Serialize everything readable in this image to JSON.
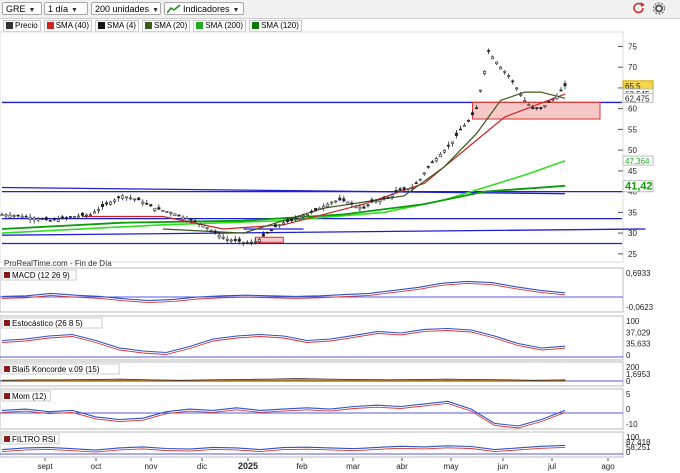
{
  "toolbar": {
    "ticker": "GRE",
    "interval": "1 día",
    "units": "200 unidades",
    "indicators_label": "Indicadores"
  },
  "legend": [
    {
      "label": "Precio",
      "color": "#333333"
    },
    {
      "label": "SMA (40)",
      "color": "#cc2222"
    },
    {
      "label": "SMA (4)",
      "color": "#111111"
    },
    {
      "label": "SMA (20)",
      "color": "#3a5a1a"
    },
    {
      "label": "SMA (200)",
      "color": "#22aa22"
    },
    {
      "label": "SMA (120)",
      "color": "#0b7a0b"
    }
  ],
  "watermark": "ProRealTime.com - Fin de Día",
  "colors": {
    "blue_line": "#1f1fd6",
    "sma200": "#33dd22",
    "sma120": "#0a9a0a",
    "sma20": "#3a5a1a",
    "sma40": "#cc2222",
    "price": "#333333"
  },
  "chart_data": [
    {
      "type": "candlestick",
      "title": "GRE",
      "ylim": [
        24,
        78
      ],
      "y_ticks": [
        "75",
        "70",
        "65",
        "60",
        "55",
        "50",
        "45",
        "40",
        "35",
        "30",
        "25"
      ],
      "x_ticks": [
        "sept",
        "oct",
        "nov",
        "dic",
        "2025",
        "feb",
        "mar",
        "abr",
        "may",
        "jun",
        "jul",
        "ago"
      ],
      "price_series": [
        [
          0,
          34.5
        ],
        [
          6,
          34
        ],
        [
          12,
          33
        ],
        [
          18,
          34
        ],
        [
          22,
          34.5
        ],
        [
          26,
          37
        ],
        [
          30,
          39
        ],
        [
          34,
          38
        ],
        [
          38,
          36
        ],
        [
          42,
          35
        ],
        [
          46,
          33.5
        ],
        [
          50,
          32
        ],
        [
          53,
          30
        ],
        [
          56,
          28.5
        ],
        [
          59,
          28
        ],
        [
          62,
          27.5
        ],
        [
          64,
          28.5
        ],
        [
          66,
          30
        ],
        [
          68,
          31.5
        ],
        [
          70,
          32.5
        ],
        [
          72,
          33
        ],
        [
          74,
          34
        ],
        [
          76,
          34.5
        ],
        [
          78,
          35.5
        ],
        [
          80,
          36.5
        ],
        [
          82,
          37.5
        ],
        [
          84,
          38
        ],
        [
          86,
          37.5
        ],
        [
          88,
          36.5
        ],
        [
          90,
          36
        ],
        [
          92,
          37.5
        ],
        [
          94,
          38
        ],
        [
          96,
          38.5
        ],
        [
          98,
          40
        ],
        [
          100,
          40.5
        ],
        [
          102,
          41
        ],
        [
          104,
          43
        ],
        [
          106,
          46
        ],
        [
          108,
          48
        ],
        [
          110,
          50
        ],
        [
          112,
          52
        ],
        [
          114,
          55
        ],
        [
          116,
          57
        ],
        [
          118,
          60
        ],
        [
          120,
          69
        ],
        [
          121,
          74
        ],
        [
          122,
          72.5
        ],
        [
          124,
          70
        ],
        [
          126,
          68
        ],
        [
          128,
          65
        ],
        [
          130,
          62
        ],
        [
          132,
          60
        ],
        [
          134,
          60
        ],
        [
          136,
          61.5
        ],
        [
          138,
          63
        ],
        [
          140,
          65.5
        ]
      ],
      "price_labels": [
        {
          "label": "65,5",
          "value": 65.5,
          "bg": "#f5d64a"
        },
        {
          "label": "63,545",
          "value": 63.55,
          "bg": "#ffffff"
        },
        {
          "label": "62,475",
          "value": 62.48,
          "bg": "#ffffff"
        },
        {
          "label": "47,364",
          "value": 47.36,
          "bg": "#ffffff"
        },
        {
          "label": "41,42",
          "value": 41.42,
          "bg": "#ffffff"
        }
      ],
      "sma20": [
        [
          40,
          31
        ],
        [
          60,
          30
        ],
        [
          80,
          36
        ],
        [
          100,
          39
        ],
        [
          110,
          46
        ],
        [
          118,
          54
        ],
        [
          124,
          62
        ],
        [
          130,
          64
        ],
        [
          134,
          64
        ],
        [
          140,
          62.5
        ]
      ],
      "sma40": [
        [
          20,
          34
        ],
        [
          40,
          34
        ],
        [
          55,
          31
        ],
        [
          70,
          32
        ],
        [
          90,
          37
        ],
        [
          105,
          42
        ],
        [
          115,
          50
        ],
        [
          125,
          58
        ],
        [
          140,
          63.5
        ]
      ],
      "sma120": [
        [
          0,
          31
        ],
        [
          30,
          32.5
        ],
        [
          60,
          33
        ],
        [
          85,
          34.5
        ],
        [
          105,
          37
        ],
        [
          120,
          40
        ],
        [
          140,
          41.4
        ]
      ],
      "sma200": [
        [
          0,
          30
        ],
        [
          40,
          32
        ],
        [
          70,
          33
        ],
        [
          95,
          35
        ],
        [
          110,
          38
        ],
        [
          120,
          41
        ],
        [
          130,
          44
        ],
        [
          140,
          47.4
        ]
      ],
      "horizontal_lines": [
        61.5,
        40,
        33.5,
        27.5
      ],
      "trend_lines": [
        {
          "from": [
            0,
            29.5
          ],
          "to": [
            160,
            31
          ]
        },
        {
          "from": [
            0,
            41
          ],
          "to": [
            140,
            39.5
          ]
        },
        {
          "from": [
            60,
            31
          ],
          "to": [
            75,
            31
          ]
        }
      ]
    },
    {
      "type": "line",
      "title": "MACD (12 26 9)",
      "ylim": [
        -2,
        3
      ],
      "y_labels": [
        "0,6933",
        "-0,0623"
      ],
      "values": [
        0.1,
        0.2,
        0.6,
        0.3,
        0.1,
        -0.3,
        -0.6,
        -0.4,
        0,
        0.2,
        0.3,
        0.2,
        0.1,
        0.2,
        0.4,
        0.6,
        1.1,
        1.6,
        2.3,
        2.6,
        2.4,
        1.7,
        1.1,
        0.7
      ]
    },
    {
      "type": "line",
      "title": "Estocástico (26 8 5)",
      "ylim": [
        0,
        100
      ],
      "y_labels": [
        "100",
        "37,029",
        "35,633",
        "0"
      ],
      "values": [
        55,
        60,
        70,
        75,
        55,
        30,
        20,
        15,
        35,
        60,
        70,
        75,
        70,
        55,
        60,
        72,
        85,
        80,
        92,
        95,
        90,
        70,
        45,
        30,
        36
      ]
    },
    {
      "type": "area",
      "title": "Blai5 Koncorde v.09 (15)",
      "ylim": [
        -5,
        20
      ],
      "y_labels": [
        "200",
        "1,6953",
        "0"
      ],
      "values": [
        2,
        3,
        3,
        4,
        5,
        3,
        2,
        3,
        4,
        5,
        6,
        5,
        4,
        3,
        4,
        5,
        4,
        3,
        2,
        3
      ]
    },
    {
      "type": "line",
      "title": "Mom (12)",
      "ylim": [
        -10,
        10
      ],
      "y_labels": [
        "5",
        "0",
        "-10"
      ],
      "values": [
        2,
        3,
        1,
        2,
        -3,
        -5,
        -4,
        1,
        3,
        2,
        4,
        2,
        3,
        4,
        3,
        5,
        6,
        5,
        7,
        9,
        3,
        -8,
        -10,
        -5,
        2
      ]
    },
    {
      "type": "line",
      "title": "FILTRO RSI",
      "ylim": [
        0,
        100
      ],
      "y_labels": [
        "100",
        "87,418",
        "58,251",
        "0"
      ],
      "values": [
        40,
        55,
        60,
        48,
        35,
        55,
        65,
        50,
        45,
        60,
        55,
        40,
        58,
        62,
        55,
        48,
        60,
        70,
        65,
        75,
        68,
        40,
        55,
        70,
        78
      ]
    }
  ]
}
